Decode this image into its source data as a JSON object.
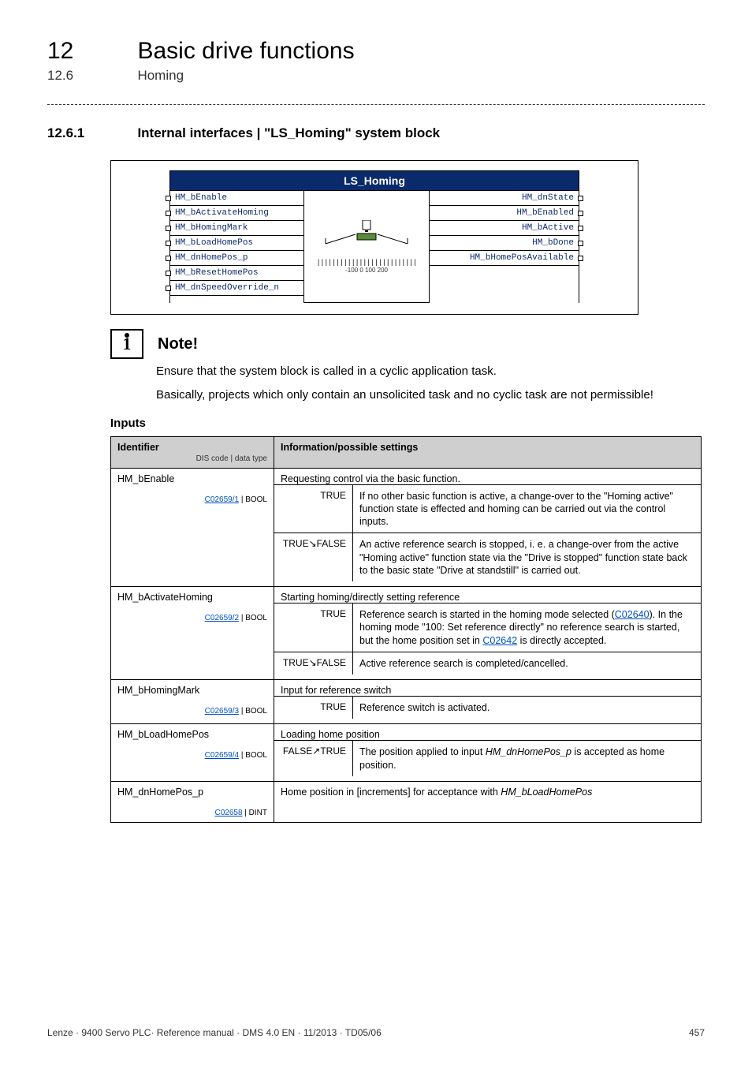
{
  "chapter": {
    "num": "12",
    "title": "Basic drive functions"
  },
  "section": {
    "num": "12.6",
    "title": "Homing"
  },
  "subsection": {
    "num": "12.6.1",
    "title": "Internal interfaces | \"LS_Homing\" system block"
  },
  "diagram": {
    "title": "LS_Homing",
    "left_ports": [
      "HM_bEnable",
      "HM_bActivateHoming",
      "HM_bHomingMark",
      "HM_bLoadHomePos",
      "HM_dnHomePos_p",
      "HM_bResetHomePos",
      "HM_dnSpeedOverride_n"
    ],
    "right_ports": [
      "HM_dnState",
      "HM_bEnabled",
      "HM_bActive",
      "HM_bDone",
      "HM_bHomePosAvailable"
    ],
    "scale_labels": "-100   0   100 200"
  },
  "note": {
    "label": "Note!",
    "p1": "Ensure that the system block is called in a cyclic application task.",
    "p2": "Basically, projects which only contain an unsolicited task and no cyclic task are not permissible!"
  },
  "inputs_heading": "Inputs",
  "th": {
    "id": "Identifier",
    "id_sub": "DIS code | data type",
    "info": "Information/possible settings"
  },
  "rows": {
    "r1": {
      "name": "HM_bEnable",
      "dis_link": "C02659/1",
      "dis_type": " | BOOL",
      "desc_top": "Requesting control via the basic function.",
      "k1": "TRUE",
      "v1": "If no other basic function is active, a change-over to the \"Homing active\" function state is effected and homing can be carried out via the control inputs.",
      "k2": "TRUE↘FALSE",
      "v2": "An active reference search is stopped, i. e. a change-over from the active \"Homing active\" function state via the \"Drive is stopped\" function state back to the basic state \"Drive at standstill\" is carried out."
    },
    "r2": {
      "name": "HM_bActivateHoming",
      "dis_link": "C02659/2",
      "dis_type": " | BOOL",
      "desc_top": "Starting homing/directly setting reference",
      "k1": "TRUE",
      "v1_a": "Reference search is started in the homing mode selected (",
      "v1_link1": "C02640",
      "v1_b": "). In the homing mode \"100: Set reference directly\" no reference search is started, but the home position set in ",
      "v1_link2": "C02642",
      "v1_c": " is directly accepted.",
      "k2": "TRUE↘FALSE",
      "v2": "Active reference search is completed/cancelled."
    },
    "r3": {
      "name": "HM_bHomingMark",
      "dis_link": "C02659/3",
      "dis_type": " | BOOL",
      "desc_top": "Input for reference switch",
      "k1": "TRUE",
      "v1": "Reference switch is activated."
    },
    "r4": {
      "name": "HM_bLoadHomePos",
      "dis_link": "C02659/4",
      "dis_type": " | BOOL",
      "desc_top": "Loading home position",
      "k1": "FALSE↗TRUE",
      "v1_a": "The position applied to input ",
      "v1_i": "HM_dnHomePos_p",
      "v1_b": " is accepted as home position."
    },
    "r5": {
      "name": "HM_dnHomePos_p",
      "dis_link": "C02658",
      "dis_type": " | DINT",
      "desc_a": "Home position in [increments] for acceptance with ",
      "desc_i": "HM_bLoadHomePos"
    }
  },
  "footer": {
    "left": "Lenze · 9400 Servo PLC· Reference manual · DMS 4.0 EN · 11/2013 · TD05/06",
    "right": "457"
  }
}
